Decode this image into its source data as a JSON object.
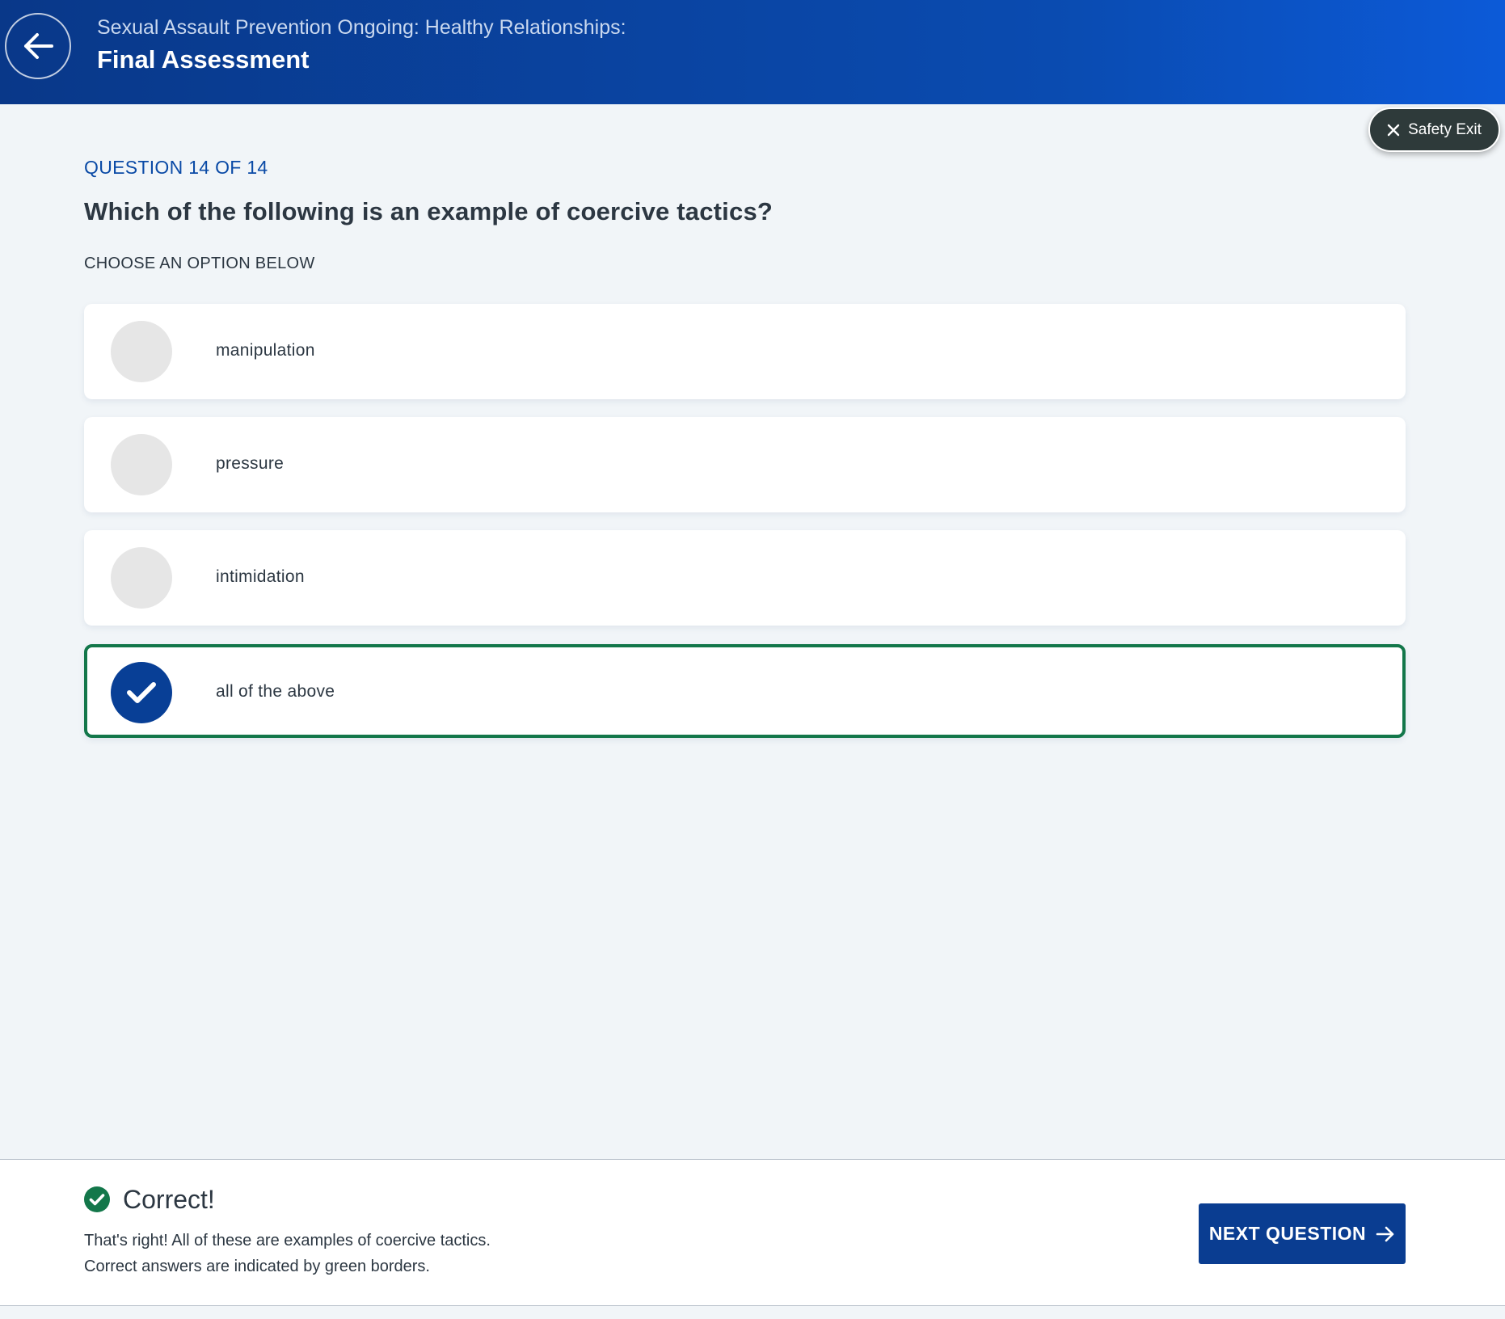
{
  "header": {
    "course_title": "Sexual Assault Prevention Ongoing: Healthy Relationships:",
    "section_title": "Final Assessment",
    "back_icon": "arrow-left-icon",
    "background": "#0a4bb0"
  },
  "safety_exit": {
    "label": "Safety Exit",
    "icon": "close-icon"
  },
  "question": {
    "counter": "QUESTION 14 OF 14",
    "text": "Which of the following is an example of coercive tactics?",
    "instruction": "CHOOSE AN OPTION BELOW"
  },
  "options": [
    {
      "label": "manipulation",
      "selected": false
    },
    {
      "label": "pressure",
      "selected": false
    },
    {
      "label": "intimidation",
      "selected": false
    },
    {
      "label": "all of the above",
      "selected": true,
      "correct": true
    }
  ],
  "feedback": {
    "title": "Correct!",
    "line1": "That's right! All of these are examples of coercive tactics.",
    "line2": "Correct answers are indicated by green borders.",
    "icon": "check-circle-icon"
  },
  "next_button": {
    "label": "NEXT QUESTION",
    "icon": "arrow-right-icon"
  },
  "colors": {
    "brand_blue": "#0a3d91",
    "correct_green": "#13774a",
    "page_bg": "#f1f5f8",
    "text_dark": "#2c3742"
  }
}
